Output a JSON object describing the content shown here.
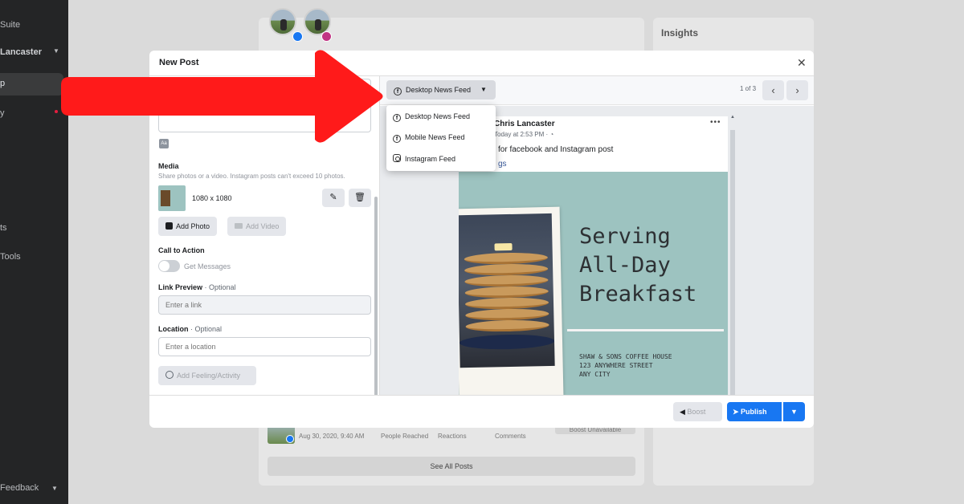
{
  "sidebar": {
    "items": [
      "Suite",
      "Lancaster",
      "y",
      "ts",
      "Tools",
      "Feedback"
    ]
  },
  "insights": {
    "title": "Insights"
  },
  "bg_post_row": {
    "date": "Aug 30, 2020, 9:40 AM",
    "people_reached": "People Reached",
    "reactions": "Reactions",
    "comments": "Comments",
    "boost_unavailable": "Boost Unavailable"
  },
  "see_all": "See All Posts",
  "modal": {
    "title": "New Post",
    "close": "✕",
    "media": {
      "label": "Media",
      "sublabel": "Share photos or a video. Instagram posts can't exceed 10 photos.",
      "dims": "1080 x 1080",
      "add_photo": "Add Photo",
      "add_video": "Add Video"
    },
    "cta": {
      "label": "Call to Action",
      "toggle_label": "Get Messages"
    },
    "link": {
      "label": "Link Preview",
      "optional": " · Optional",
      "placeholder": "Enter a link"
    },
    "location": {
      "label": "Location",
      "optional": " · Optional",
      "placeholder": "Enter a location"
    },
    "feeling": "Add Feeling/Activity",
    "placement": {
      "selected": "Desktop News Feed",
      "options": [
        "Desktop News Feed",
        "Mobile News Feed",
        "Instagram Feed"
      ],
      "pager": "1 of 3"
    },
    "preview": {
      "author": "Chris Lancaster",
      "time": "Today at 2:53 PM · ",
      "text": "for facebook and Instagram post",
      "link_fragment": "gs",
      "headline": "Serving\nAll-Day\nBreakfast",
      "address": "SHAW & SONS COFFEE HOUSE\n123 ANYWHERE STREET\nANY CITY"
    },
    "footer": {
      "boost": "Boost",
      "publish": "Publish"
    }
  },
  "colors": {
    "accent": "#1877f2",
    "arrow": "#ff1a1a",
    "poster_bg": "#9dc3c0"
  }
}
